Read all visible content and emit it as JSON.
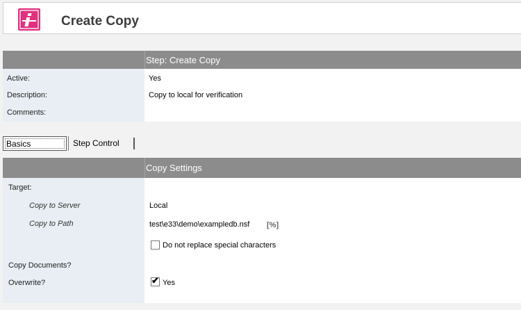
{
  "header": {
    "title": "Create Copy",
    "logo_icon": "info-i-icon",
    "logo_color": "#e0317e"
  },
  "step": {
    "title": "Step:  Create Copy",
    "fields": [
      {
        "label": "Active:",
        "value": "Yes"
      },
      {
        "label": "Description:",
        "value": "Copy to local for verification"
      },
      {
        "label": "Comments:",
        "value": ""
      }
    ]
  },
  "tabs": {
    "basics": "Basics",
    "step_control": "Step Control",
    "active": "Basics"
  },
  "settings": {
    "title": "Copy Settings",
    "target_label": "Target:",
    "copy_to_server_label": "Copy to Server",
    "copy_to_server_value": "Local",
    "copy_to_path_label": "Copy to Path",
    "copy_to_path_value": "test\\e33\\demo\\exampledb.nsf",
    "path_formula_link": "[%]",
    "special_chars_label": "Do not replace special characters",
    "special_chars_checked": false,
    "copy_documents_label": "Copy Documents?",
    "overwrite_label": "Overwrite?",
    "overwrite_option": "Yes",
    "overwrite_checked": true
  }
}
